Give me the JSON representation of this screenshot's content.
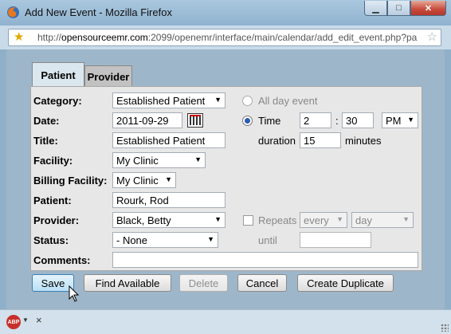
{
  "window": {
    "title": "Add New Event - Mozilla Firefox",
    "url_prefix": "http://",
    "url_host": "opensourceemr.com",
    "url_rest": ":2099/openemr/interface/main/calendar/add_edit_event.php?pa"
  },
  "tabs": [
    {
      "label": "Patient",
      "active": true
    },
    {
      "label": "Provider",
      "active": false
    }
  ],
  "form": {
    "category_label": "Category:",
    "category_value": "Established Patient",
    "date_label": "Date:",
    "date_value": "2011-09-29",
    "title_label": "Title:",
    "title_value": "Established Patient",
    "facility_label": "Facility:",
    "facility_value": "My Clinic",
    "billing_facility_label": "Billing Facility:",
    "billing_facility_value": "My Clinic",
    "patient_label": "Patient:",
    "patient_value": "Rourk, Rod",
    "provider_label": "Provider:",
    "provider_value": "Black, Betty",
    "status_label": "Status:",
    "status_value": "- None",
    "comments_label": "Comments:",
    "comments_value": ""
  },
  "time": {
    "all_day_label": "All day event",
    "time_label": "Time",
    "hour": "2",
    "separator": ":",
    "minute": "30",
    "ampm": "PM",
    "duration_label": "duration",
    "duration_value": "15",
    "minutes_label": "minutes"
  },
  "repeat": {
    "repeats_label": "Repeats",
    "every_value": "every",
    "unit_value": "day",
    "until_label": "until"
  },
  "buttons": {
    "save": "Save",
    "find_available": "Find Available",
    "delete": "Delete",
    "cancel": "Cancel",
    "create_duplicate": "Create Duplicate"
  },
  "status": {
    "abp_label": "ABP",
    "close_glyph": "×"
  }
}
